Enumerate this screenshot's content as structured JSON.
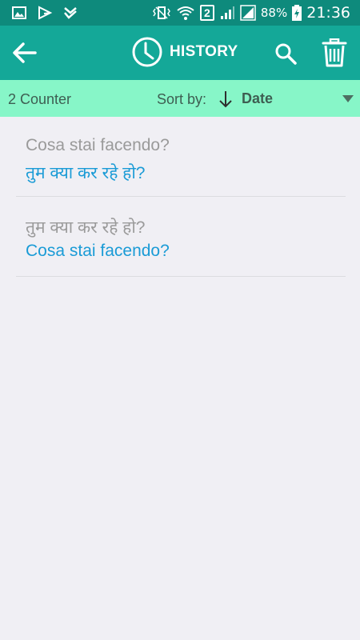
{
  "statusbar": {
    "sim_slot": "2",
    "battery_percent": "88%",
    "time": "21:36",
    "icons": [
      "gallery-icon",
      "play-store-icon",
      "check-icon",
      "vibrate-icon",
      "wifi-icon",
      "sim-2-icon",
      "signal-icon",
      "signal-icon",
      "battery-charging-icon"
    ]
  },
  "toolbar": {
    "title": "HISTORY",
    "icons": [
      "back-arrow-icon",
      "clock-icon",
      "search-icon",
      "trash-icon"
    ]
  },
  "sortbar": {
    "counter": "2 Counter",
    "sort_label": "Sort by:",
    "sort_value": "Date",
    "icons": [
      "sort-down-arrow-icon",
      "dropdown-triangle-icon"
    ]
  },
  "history": {
    "items": [
      {
        "source": "Cosa stai facendo?",
        "target": "तुम क्या कर रहे हो?"
      },
      {
        "source": "तुम क्या कर रहे हो?",
        "target": "Cosa stai facendo?"
      }
    ]
  },
  "colors": {
    "statusbar": "#0e8a7c",
    "toolbar": "#14a898",
    "sortbar": "#87f6c8",
    "background": "#f0eff4",
    "source_text": "#9a9a9a",
    "target_text": "#1a9bd6"
  }
}
